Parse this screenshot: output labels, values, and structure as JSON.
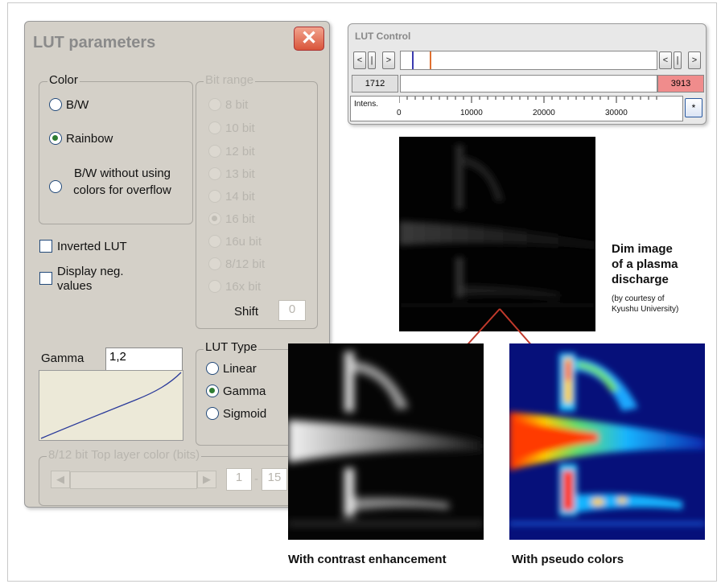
{
  "lut_parameters": {
    "title": "LUT parameters",
    "close_glyph": "✕",
    "color_group": {
      "label": "Color",
      "options": [
        "B/W",
        "Rainbow",
        "B/W without using colors for overflow"
      ],
      "selected": "Rainbow"
    },
    "bit_range_group": {
      "label": "Bit range",
      "options": [
        "8 bit",
        "10 bit",
        "12 bit",
        "13 bit",
        "14 bit",
        "16 bit",
        "16u bit",
        "8/12 bit",
        "16x bit"
      ],
      "selected": "16 bit",
      "shift_label": "Shift",
      "shift_value": "0"
    },
    "inverted_lut_label": "Inverted LUT",
    "display_neg_label_1": "Display neg.",
    "display_neg_label_2": "values",
    "gamma_label": "Gamma",
    "gamma_value": "1,2",
    "lut_type_group": {
      "label": "LUT Type",
      "options": [
        "Linear",
        "Gamma",
        "Sigmoid"
      ],
      "selected": "Gamma"
    },
    "top_layer_group": {
      "label": "8/12 bit Top layer color (bits)",
      "from_value": "1",
      "separator": "-",
      "to_value": "15"
    }
  },
  "lut_control": {
    "title": "LUT Control",
    "min_value": "1712",
    "max_value": "3913",
    "intens_label": "Intens.",
    "axis_ticks": [
      "0",
      "10000",
      "20000",
      "30000"
    ],
    "star_button": "*"
  },
  "captions": {
    "dim_title_1": "Dim image",
    "dim_title_2": "of a plasma",
    "dim_title_3": "discharge",
    "courtesy_1": "(by courtesy of",
    "courtesy_2": "Kyushu University)",
    "contrast": "With contrast enhancement",
    "pseudo": "With pseudo colors"
  },
  "colors": {
    "accent_red": "#c0392b",
    "radio_selected": "#2e7d32",
    "max_value_bg": "#f08c8c",
    "min_marker": "#3b3bb0",
    "max_marker": "#e07030"
  }
}
